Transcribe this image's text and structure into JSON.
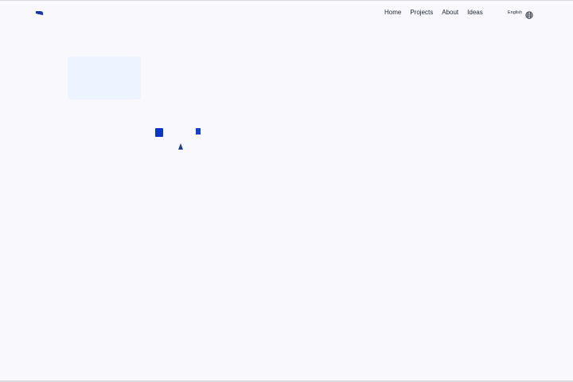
{
  "header": {
    "nav": [
      {
        "label": "Home"
      },
      {
        "label": "Projects"
      },
      {
        "label": "About"
      },
      {
        "label": "Ideas"
      }
    ],
    "language": {
      "label": "English",
      "icon": "globe-icon"
    },
    "logo_icon": "brand-logo-icon"
  },
  "colors": {
    "background": "#f9f9fd",
    "accent": "#0a35c9",
    "text": "#1d2430",
    "hero_box": "#eef4ff"
  }
}
